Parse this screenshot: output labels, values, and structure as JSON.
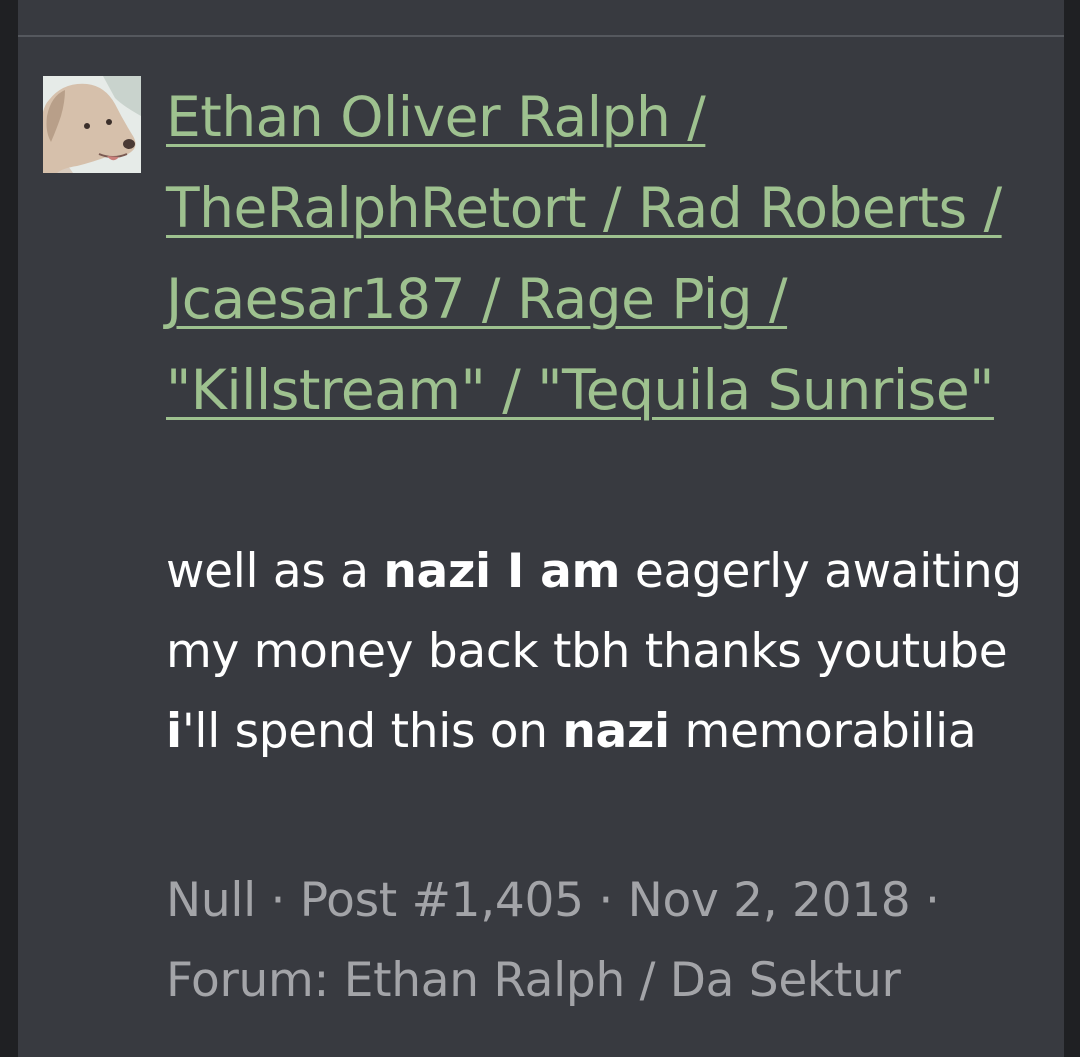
{
  "result": {
    "title": "Ethan Oliver Ralph / TheRalphRetort / Rad Roberts / Jcaesar187 / Rage Pig / \"Killstream\" / \"Tequila Sunrise\"",
    "snippet": {
      "t1": "well as a ",
      "h1": "nazi I am",
      "t2": " eagerly awaiting my money back tbh thanks youtube ",
      "h2": "i",
      "t3": "'ll spend this on ",
      "h3": "nazi",
      "t4": " memorabilia"
    },
    "meta": {
      "author": "Null",
      "sep": " · ",
      "post": "Post #1,405",
      "date": "Nov 2, 2018",
      "forum_prefix": "Forum: ",
      "forum": "Ethan Ralph / Da Sektur"
    }
  },
  "colors": {
    "background": "#383a40",
    "link": "#9ec18f",
    "text": "#ffffff",
    "meta": "#a3a4a8"
  },
  "icons": {
    "avatar": "dog-avatar"
  }
}
